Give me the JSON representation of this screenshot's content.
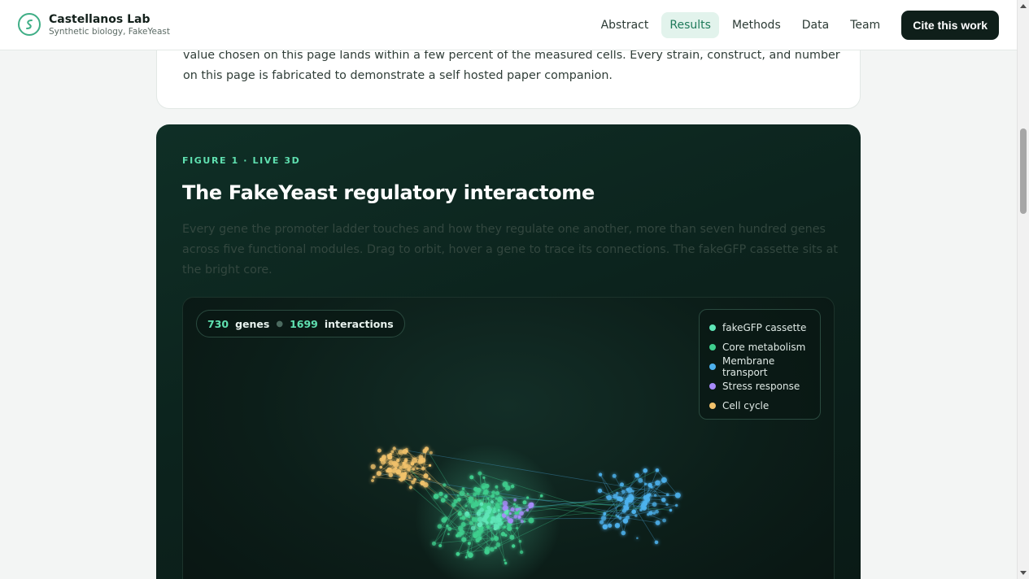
{
  "header": {
    "lab_name": "Castellanos Lab",
    "lab_subtitle": "Synthetic biology, FakeYeast",
    "nav": [
      {
        "label": "Abstract",
        "active": false
      },
      {
        "label": "Results",
        "active": true
      },
      {
        "label": "Methods",
        "active": false
      },
      {
        "label": "Data",
        "active": false
      },
      {
        "label": "Team",
        "active": false
      }
    ],
    "cite_label": "Cite this work"
  },
  "abstract": {
    "tail_text": "value chosen on this page lands within a few percent of the measured cells. Every strain, construct, and number on this page is fabricated to demonstrate a self hosted paper companion."
  },
  "figure": {
    "eyebrow": "FIGURE 1 · LIVE 3D",
    "title": "The FakeYeast regulatory interactome",
    "description": "Every gene the promoter ladder touches and how they regulate one another, more than seven hundred genes across five functional modules. Drag to orbit, hover a gene to trace its connections. The fakeGFP cassette sits at the bright core.",
    "stats": {
      "genes_count": "730",
      "genes_label": "genes",
      "interactions_count": "1699",
      "interactions_label": "interactions"
    },
    "legend": [
      {
        "label": "fakeGFP cassette",
        "color": "#5fe6b8"
      },
      {
        "label": "Core metabolism",
        "color": "#3fcf8e"
      },
      {
        "label": "Membrane transport",
        "color": "#4db2ee"
      },
      {
        "label": "Stress response",
        "color": "#a78bfa"
      },
      {
        "label": "Cell cycle",
        "color": "#f2c26b"
      }
    ]
  }
}
